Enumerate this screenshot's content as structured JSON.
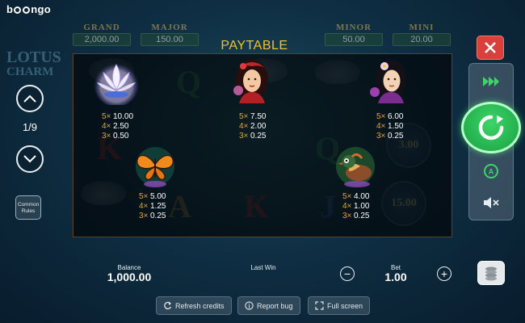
{
  "brand": {
    "logo_text": "bgaming_logo"
  },
  "jackpots": [
    {
      "name": "GRAND",
      "value": "2,000.00"
    },
    {
      "name": "MAJOR",
      "value": "150.00"
    },
    {
      "name": "MINOR",
      "value": "50.00"
    },
    {
      "name": "MINI",
      "value": "20.00"
    }
  ],
  "background_game": {
    "title_line1": "LOTUS",
    "title_line2": "CHARM"
  },
  "paytable": {
    "title": "PAYTABLE",
    "page": "1/9",
    "symbols": [
      {
        "name": "white-lotus",
        "pays": [
          {
            "count": "5×",
            "value": "10.00"
          },
          {
            "count": "4×",
            "value": "2.50"
          },
          {
            "count": "3×",
            "value": "0.50"
          }
        ]
      },
      {
        "name": "red-girl",
        "pays": [
          {
            "count": "5×",
            "value": "7.50"
          },
          {
            "count": "4×",
            "value": "2.00"
          },
          {
            "count": "3×",
            "value": "0.25"
          }
        ]
      },
      {
        "name": "black-hair-girl",
        "pays": [
          {
            "count": "5×",
            "value": "6.00"
          },
          {
            "count": "4×",
            "value": "1.50"
          },
          {
            "count": "3×",
            "value": "0.25"
          }
        ]
      },
      {
        "name": "butterfly",
        "pays": [
          {
            "count": "5×",
            "value": "5.00"
          },
          {
            "count": "4×",
            "value": "1.25"
          },
          {
            "count": "3×",
            "value": "0.25"
          }
        ]
      },
      {
        "name": "mandarin-duck",
        "pays": [
          {
            "count": "5×",
            "value": "4.00"
          },
          {
            "count": "4×",
            "value": "1.00"
          },
          {
            "count": "3×",
            "value": "0.25"
          }
        ]
      }
    ]
  },
  "controls": {
    "rules_label": "Common Rules"
  },
  "bottom": {
    "balance_label": "Balance",
    "balance_value": "1,000.00",
    "last_win_label": "Last Win",
    "bet_label": "Bet",
    "bet_value": "1.00",
    "minus": "−",
    "plus": "+"
  },
  "utility": {
    "refresh": "Refresh credits",
    "report": "Report bug",
    "fullscreen": "Full screen"
  },
  "colors": {
    "accent_gold": "#f2c12e",
    "spin_green": "#18a142",
    "close_red": "#d9403b"
  }
}
